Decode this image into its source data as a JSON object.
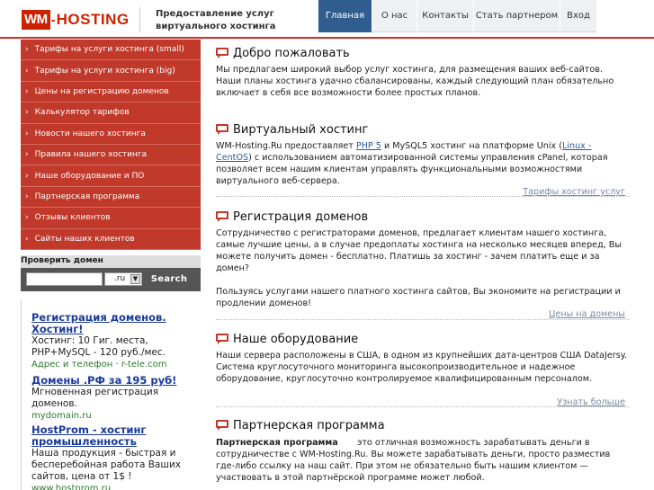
{
  "header": {
    "logo_wm": "WM",
    "logo_dash": "-",
    "logo_hosting": "HOSTING",
    "tagline": "Предоставление услуг виртуального хостинга",
    "nav": [
      {
        "label": "Главная",
        "active": true
      },
      {
        "label": "О нас",
        "active": false
      },
      {
        "label": "Контакты",
        "active": false
      },
      {
        "label": "Стать партнером",
        "active": false
      },
      {
        "label": "Вход",
        "active": false
      }
    ]
  },
  "sidebar": {
    "items": [
      {
        "label": "Тарифы на услуги хостинга (small)"
      },
      {
        "label": "Тарифы на услуги хостинга (big)"
      },
      {
        "label": "Цены на регистрацию доменов"
      },
      {
        "label": "Калькулятор тарифов"
      },
      {
        "label": "Новости нашего хостинга"
      },
      {
        "label": "Правила нашего хостинга"
      },
      {
        "label": "Наше оборудование и ПО"
      },
      {
        "label": "Партнерская программа"
      },
      {
        "label": "Отзывы клиентов"
      },
      {
        "label": "Сайты наших клиентов"
      }
    ]
  },
  "domain_check": {
    "title": "Проверить домен",
    "input_value": "",
    "zone": ".ru",
    "search_label": "Search"
  },
  "ads": [
    {
      "title": "Регистрация доменов. Хостинг!",
      "text": "Хостинг: 10 Гиг. места, PHP+MySQL - 120 руб./мес.",
      "url": "Адрес и телефон",
      "url_sep": "·",
      "url2": "r-tele.com"
    },
    {
      "title": "Домены .РФ за 195 руб!",
      "text": "Мгновенная регистрация доменов.",
      "url": "mydomain.ru"
    },
    {
      "title": "HostProm - хостинг промышленность",
      "text": "Наша продукция - быстрая и бесперебойная работа Ваших сайтов, цена от 1$ !",
      "url": "www.hostprom.ru"
    }
  ],
  "sections": {
    "welcome": {
      "title": "Добро пожаловать",
      "body": "Мы предлагаем широкий выбор услуг хостинга, для размещения ваших веб-сайтов. Наши планы хостинга удачно сбалансированы, каждый следующий план обязательно включает в себя все возможности более простых планов."
    },
    "virtual": {
      "title": "Виртуальный хостинг",
      "body_1": "WM-Hosting.Ru предоставляет ",
      "link_php": "PHP 5",
      "body_2": " и MySQL5 хостинг на платформе Unix (",
      "link_linux": "Linux - CentOS",
      "body_3": ") с использованием автоматизированной системы управления cPanel, которая позволяет всем нашим клиентам управлять функциональными возможностями виртуального веб-сервера.",
      "more": "Тарифы хостинг услуг"
    },
    "domains": {
      "title": "Регистрация доменов",
      "body_1": "Сотрудничество с регистраторами доменов, предлагает клиентам нашего хостинга, самые лучшие цены, а в случае предоплаты хостинга на несколько месяцев вперед, Вы можете получить домен - бесплатно. Платишь за хостинг - зачем платить еще и за домен?",
      "body_2": "Пользуясь услугами нашего платного хостинга сайтов, Вы экономите на регистрации и продлении доменов!",
      "more": "Цены на домены"
    },
    "equipment": {
      "title": "Наше оборудование",
      "body": "Наши сервера расположены в США, в одном из крупнейших дата-центров США DataJersy. Система круглосуточного мониторинга   высокопроизводительное и надежное оборудование, круглосуточно контролируемое квалифицированным персоналом.",
      "more": "Узнать больше"
    },
    "partner": {
      "title": "Партнерская программа",
      "body_bold": "Партнерская программа",
      "body": "       это отличная возможность зарабатывать деньги в сотрудничестве с WM-Hosting.Ru. Вы можете зарабатывать деньги, просто разместив где-либо ссылку на наш сайт. При этом не обязательно быть нашим клиентом — участвовать в этой партнёрской программе может любой."
    }
  },
  "colors": {
    "brand_red": "#c0392b",
    "nav_active": "#2f5e8e",
    "link_blue": "#1a3a99"
  }
}
